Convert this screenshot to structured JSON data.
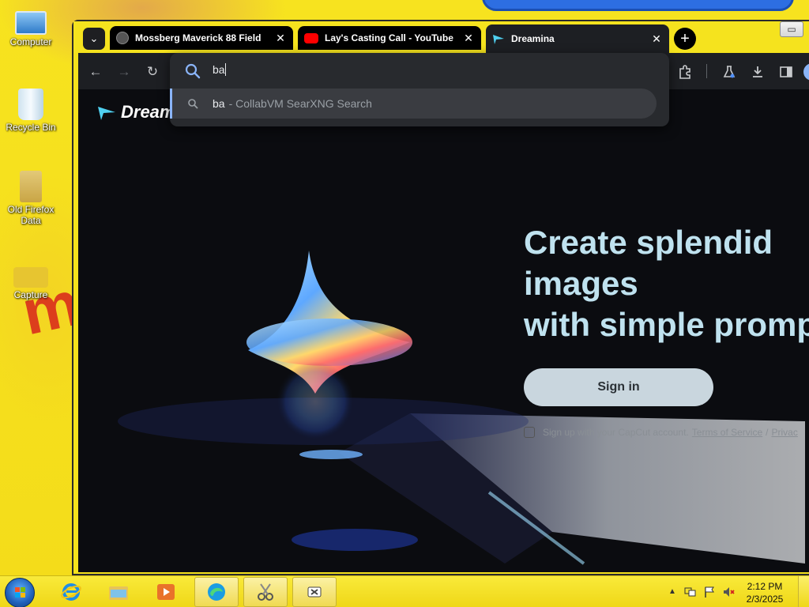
{
  "desktop": {
    "icons": [
      {
        "label": "Computer",
        "icon": "computer-icon"
      },
      {
        "label": "Recycle Bin",
        "icon": "recycle-bin-icon"
      },
      {
        "label": "Old Firefox Data",
        "icon": "folder-icon"
      },
      {
        "label": "Capture",
        "icon": "capture-icon"
      }
    ]
  },
  "browser": {
    "tabs": [
      {
        "title": "Mossberg Maverick 88 Field",
        "close": "✕",
        "favicon": "site-favicon"
      },
      {
        "title": "Lay's Casting Call - YouTube",
        "close": "✕",
        "favicon": "youtube-icon"
      },
      {
        "title": "Dreamina",
        "close": "✕",
        "favicon": "dreamina-icon"
      }
    ],
    "active_tab": 2,
    "new_tab": "+",
    "tab_menu": "⌄",
    "omnibox": {
      "query": "ba",
      "suggestion_text": "ba",
      "suggestion_source": "- CollabVM SearXNG Search"
    },
    "toolbar": {
      "back": "←",
      "forward": "→",
      "reload": "↻"
    }
  },
  "page": {
    "logo_text": "Dream",
    "hero_lines": [
      "Create splendid",
      "images",
      "with simple promp"
    ],
    "signin_label": "Sign in",
    "terms_text": "Sign up with your CapCut account.",
    "terms_link": "Terms of Service",
    "terms_sep": "/",
    "privacy_link": "Privac"
  },
  "taskbar": {
    "clock_time": "2:12 PM",
    "clock_date": "2/3/2025"
  },
  "colors": {
    "accent": "#8ab4f8",
    "hero_text": "#bfe2ef",
    "taskbar": "#f4e21c"
  }
}
